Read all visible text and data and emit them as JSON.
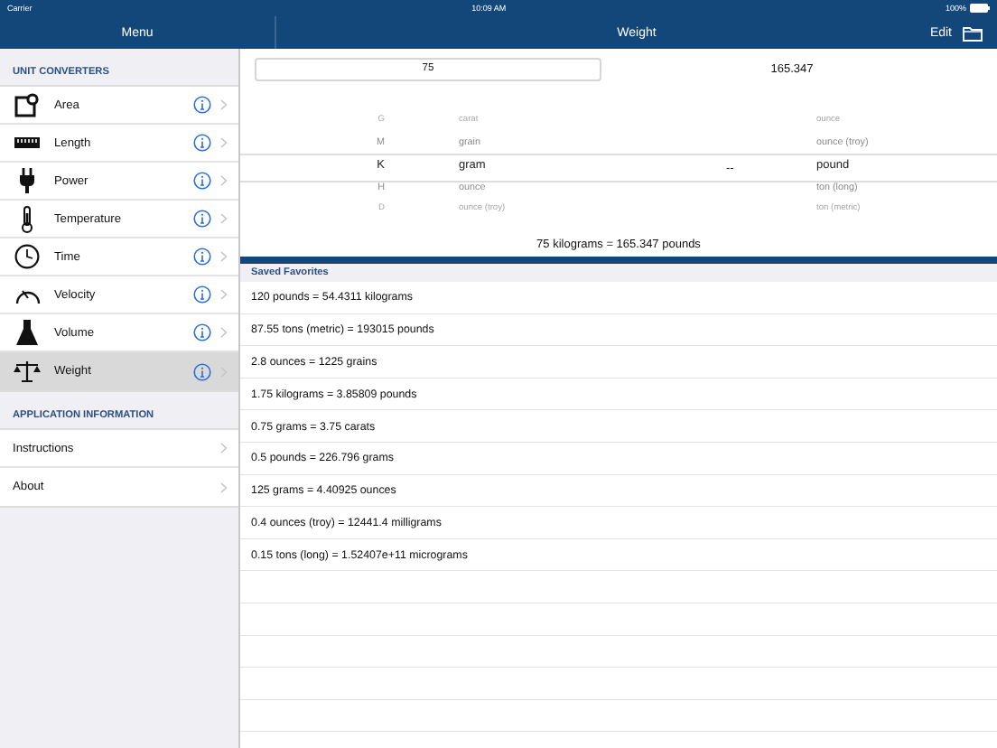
{
  "status_bar": {
    "carrier": "Carrier",
    "time": "10:09 AM",
    "battery": "100%"
  },
  "sidebar": {
    "title": "Menu",
    "sections": [
      {
        "header": "UNIT CONVERTERS",
        "items": [
          {
            "label": "Area",
            "kind": "area",
            "selected": false
          },
          {
            "label": "Length",
            "kind": "ruler",
            "selected": false
          },
          {
            "label": "Power",
            "kind": "plug",
            "selected": false
          },
          {
            "label": "Temperature",
            "kind": "thermometer",
            "selected": false
          },
          {
            "label": "Time",
            "kind": "clock",
            "selected": false
          },
          {
            "label": "Velocity",
            "kind": "gauge",
            "selected": false
          },
          {
            "label": "Volume",
            "kind": "flask",
            "selected": false
          },
          {
            "label": "Weight",
            "kind": "scale",
            "selected": true
          }
        ]
      },
      {
        "header": "APPLICATION INFORMATION",
        "items": [
          {
            "label": "Instructions",
            "selected": false
          },
          {
            "label": "About",
            "selected": false
          }
        ]
      }
    ]
  },
  "main": {
    "title": "Weight",
    "edit": "Edit",
    "input": {
      "value": "75"
    },
    "output": "165.347",
    "picker": {
      "prefixes": [
        {
          "label": "G",
          "selected": false
        },
        {
          "label": "M",
          "selected": false
        },
        {
          "label": "K",
          "selected": true
        },
        {
          "label": "H",
          "selected": false
        },
        {
          "label": "D",
          "selected": false
        }
      ],
      "from_units": [
        {
          "label": "carat",
          "selected": false
        },
        {
          "label": "grain",
          "selected": false
        },
        {
          "label": "gram",
          "selected": true
        },
        {
          "label": "ounce",
          "selected": false
        },
        {
          "label": "ounce (troy)",
          "selected": false
        }
      ],
      "separator": "--",
      "to_units": [
        {
          "label": "ounce",
          "selected": false
        },
        {
          "label": "ounce (troy)",
          "selected": false
        },
        {
          "label": "pound",
          "selected": true
        },
        {
          "label": "ton (long)",
          "selected": false
        },
        {
          "label": "ton (metric)",
          "selected": false
        }
      ]
    },
    "result": "75 kilograms = 165.347 pounds",
    "favorites": {
      "header": "Saved Favorites",
      "items": [
        "120 pounds = 54.4311 kilograms",
        "87.55 tons (metric) = 193015 pounds",
        "2.8 ounces = 1225 grains",
        "1.75 kilograms = 3.85809 pounds",
        "0.75 grams = 3.75 carats",
        "0.5 pounds = 226.796 grams",
        "125 grams = 4.40925 ounces",
        "0.4 ounces (troy) = 12441.4 milligrams",
        "0.15 tons (long) = 1.52407e+11 micrograms"
      ]
    }
  }
}
